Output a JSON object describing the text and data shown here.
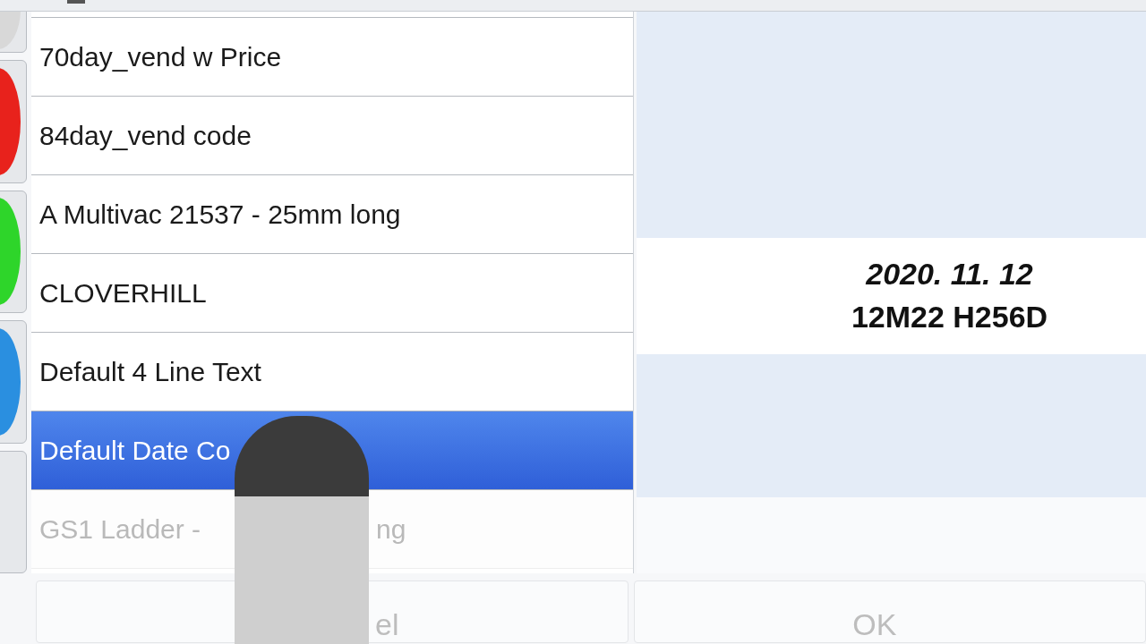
{
  "side_buttons": [
    {
      "kind": "grey"
    },
    {
      "kind": "red"
    },
    {
      "kind": "green"
    },
    {
      "kind": "blue"
    },
    {
      "kind": "blank"
    }
  ],
  "items": [
    {
      "text_parts": [
        "70day_vend w Price"
      ],
      "selected": false,
      "disabled": false
    },
    {
      "text_parts": [
        "84day_vend code"
      ],
      "selected": false,
      "disabled": false
    },
    {
      "text_parts": [
        "A Multivac 21537 - 25mm long"
      ],
      "selected": false,
      "disabled": false
    },
    {
      "text_parts": [
        "CLOVERHILL"
      ],
      "selected": false,
      "disabled": false
    },
    {
      "text_parts": [
        "Default 4 Line Text"
      ],
      "selected": false,
      "disabled": false
    },
    {
      "text_parts": [
        "Default Date Co"
      ],
      "selected": true,
      "disabled": false
    },
    {
      "text_parts": [
        "GS1 Ladder -",
        "ng"
      ],
      "selected": false,
      "disabled": true
    }
  ],
  "preview": {
    "lines": [
      "2020. 11. 12",
      "12M22 H256D"
    ]
  },
  "buttons": [
    {
      "label": "el",
      "disabled": true
    },
    {
      "label": "OK",
      "disabled": true
    }
  ]
}
